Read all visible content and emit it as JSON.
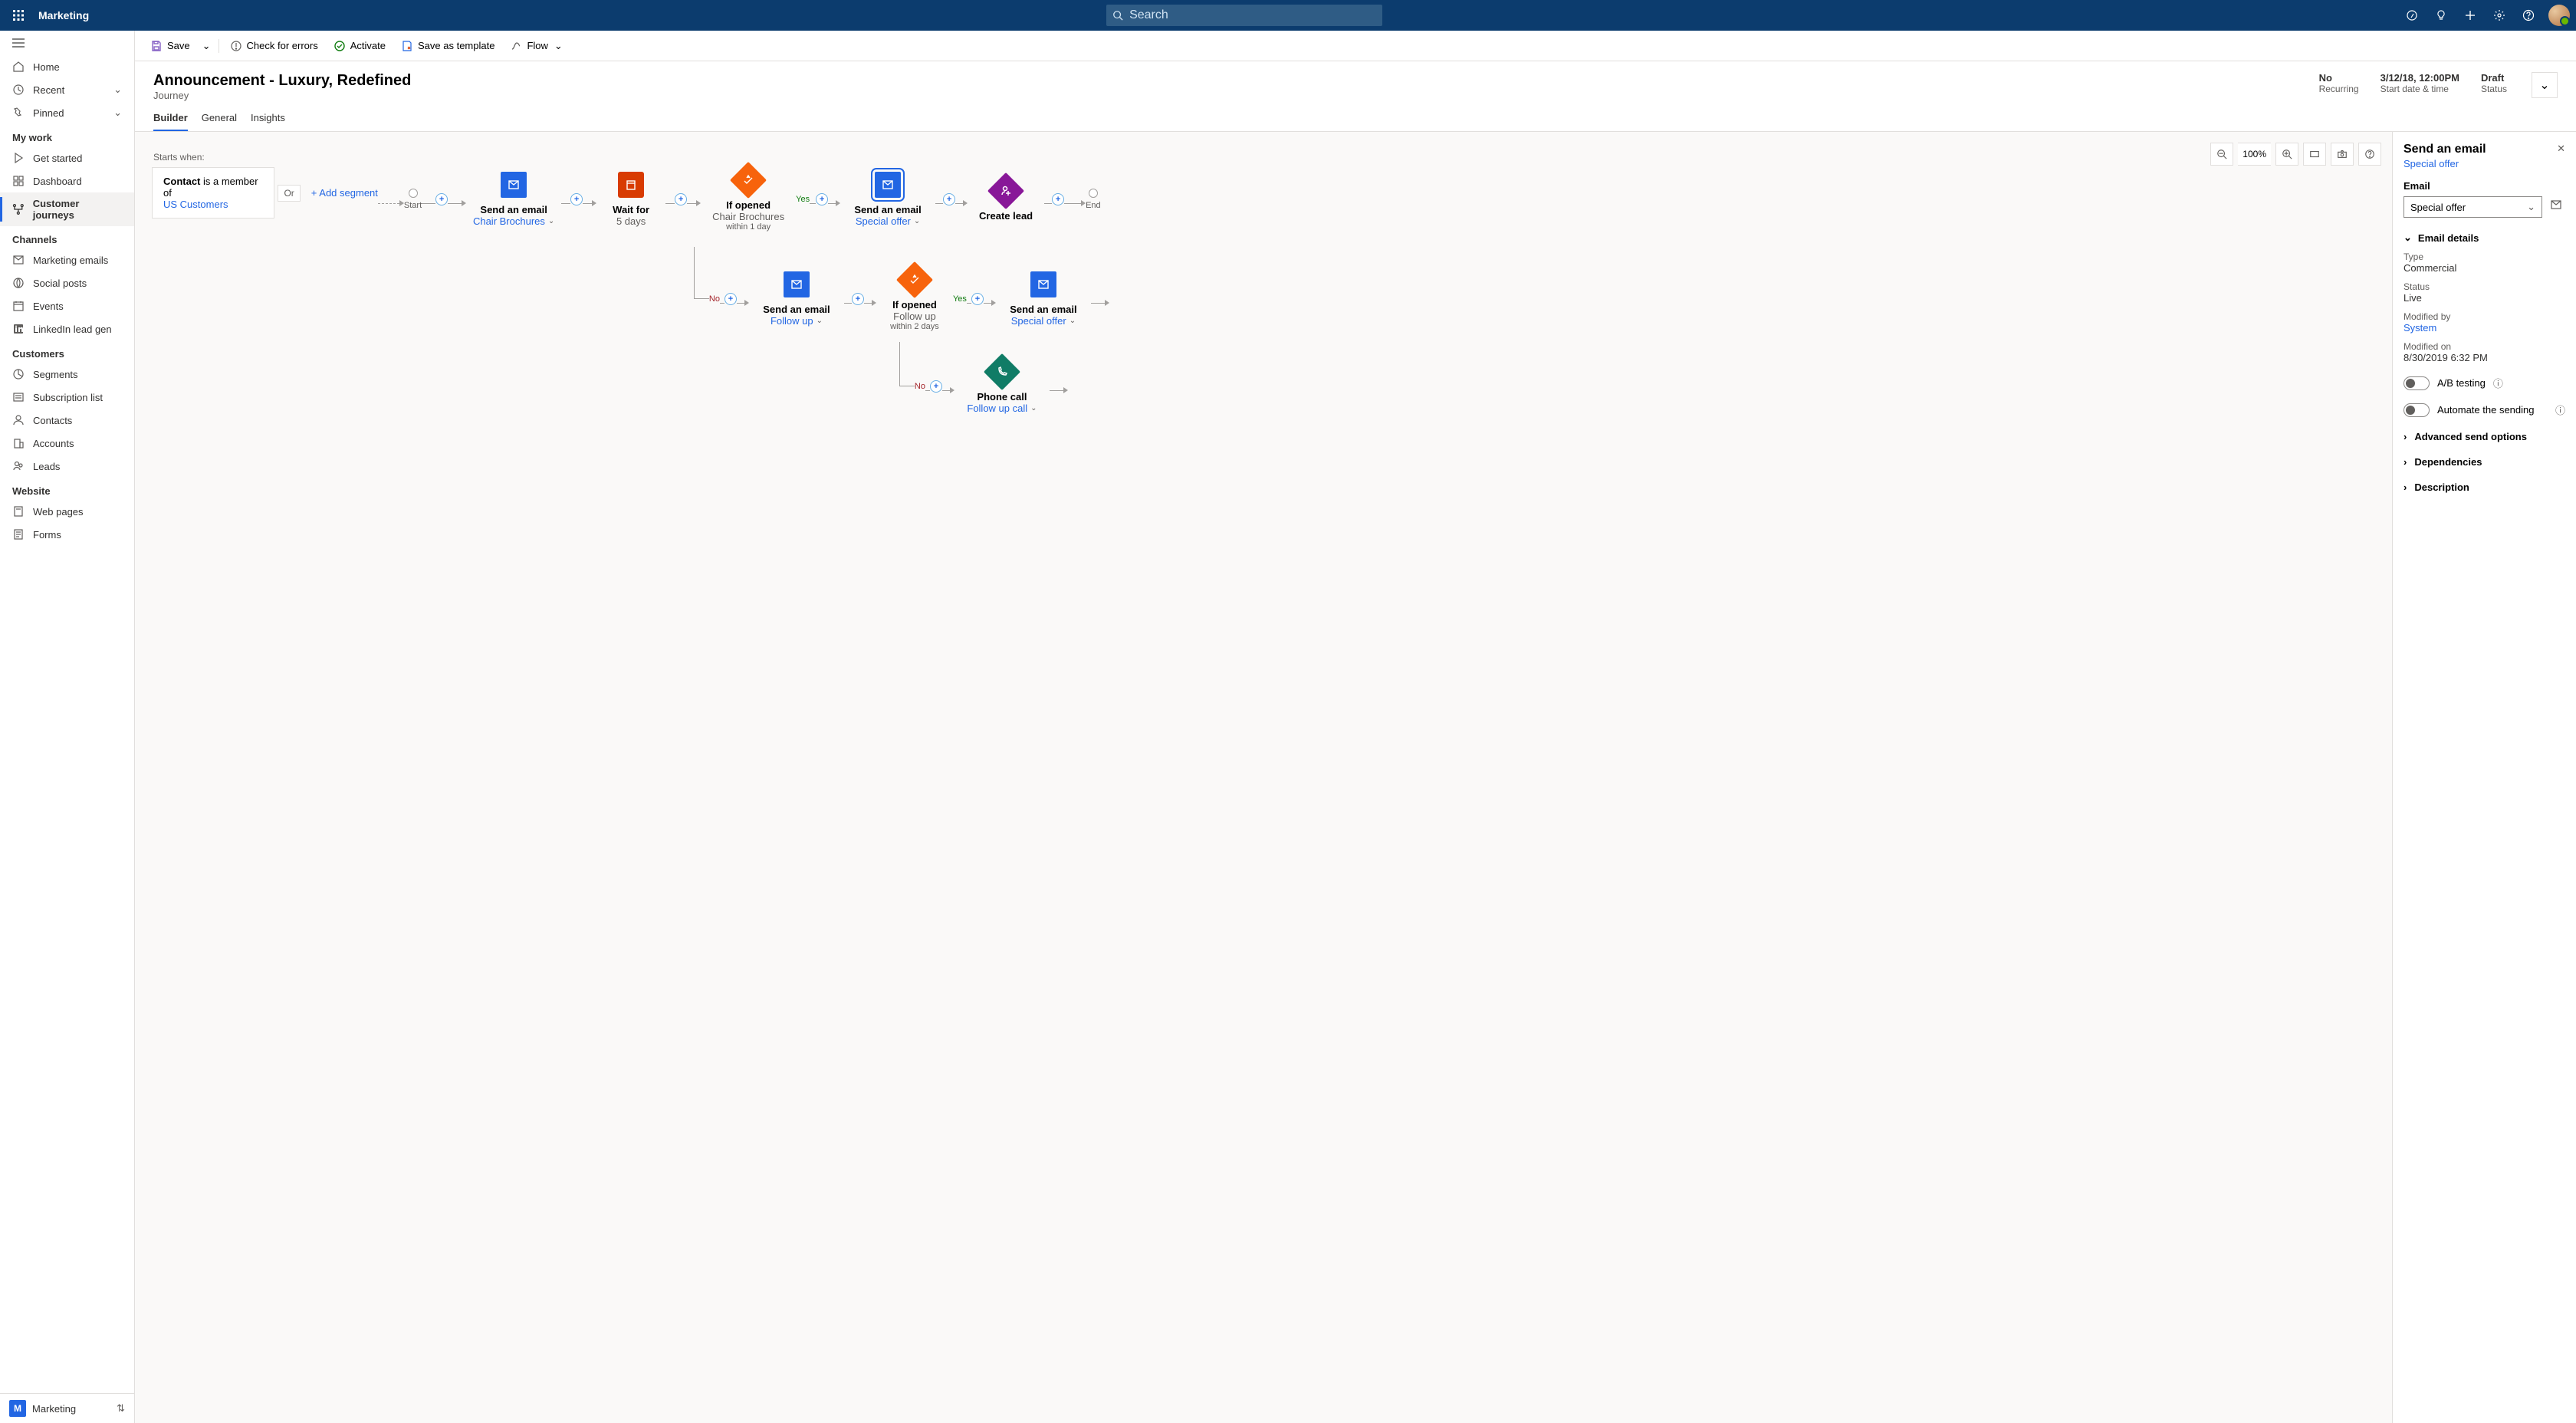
{
  "app_title": "Marketing",
  "search_placeholder": "Search",
  "sidebar": {
    "home": "Home",
    "recent": "Recent",
    "pinned": "Pinned",
    "sections": {
      "my_work": "My work",
      "channels": "Channels",
      "customers": "Customers",
      "website": "Website"
    },
    "items": {
      "get_started": "Get started",
      "dashboard": "Dashboard",
      "customer_journeys": "Customer journeys",
      "marketing_emails": "Marketing emails",
      "social_posts": "Social posts",
      "events": "Events",
      "linkedin": "LinkedIn lead gen",
      "segments": "Segments",
      "subscription_list": "Subscription list",
      "contacts": "Contacts",
      "accounts": "Accounts",
      "leads": "Leads",
      "web_pages": "Web pages",
      "forms": "Forms"
    },
    "area_letter": "M",
    "area_name": "Marketing"
  },
  "commands": {
    "save": "Save",
    "check": "Check for errors",
    "activate": "Activate",
    "save_as_template": "Save as template",
    "flow": "Flow"
  },
  "header": {
    "title": "Announcement - Luxury, Redefined",
    "subtitle": "Journey",
    "meta": {
      "recurring_val": "No",
      "recurring_lbl": "Recurring",
      "start_val": "3/12/18, 12:00PM",
      "start_lbl": "Start date & time",
      "status_val": "Draft",
      "status_lbl": "Status"
    }
  },
  "tabs": {
    "builder": "Builder",
    "general": "General",
    "insights": "Insights"
  },
  "canvas": {
    "zoom": "100%",
    "starts_when": "Starts when:",
    "contact": "Contact",
    "is_member": "is a member of",
    "segment": "US Customers",
    "or": "Or",
    "add_segment": "+ Add segment",
    "start": "Start",
    "end": "End",
    "yes": "Yes",
    "no": "No",
    "nodes": {
      "n1": {
        "title": "Send an email",
        "sub": "Chair Brochures"
      },
      "n2": {
        "title": "Wait for",
        "sub": "5 days"
      },
      "n3": {
        "title": "If opened",
        "sub": "Chair Brochures",
        "sm": "within 1 day"
      },
      "n4": {
        "title": "Send an email",
        "sub": "Special offer"
      },
      "n5": {
        "title": "Create lead"
      },
      "n6": {
        "title": "Send an email",
        "sub": "Follow up"
      },
      "n7": {
        "title": "If opened",
        "sub": "Follow up",
        "sm": "within 2 days"
      },
      "n8": {
        "title": "Send an email",
        "sub": "Special offer"
      },
      "n9": {
        "title": "Phone call",
        "sub": "Follow up call"
      }
    }
  },
  "rpanel": {
    "title": "Send an email",
    "sub": "Special offer",
    "email_label": "Email",
    "email_value": "Special offer",
    "details": "Email details",
    "type_lbl": "Type",
    "type_val": "Commercial",
    "status_lbl": "Status",
    "status_val": "Live",
    "modby_lbl": "Modified by",
    "modby_val": "System",
    "modon_lbl": "Modified on",
    "modon_val": "8/30/2019  6:32 PM",
    "ab_testing": "A/B testing",
    "automate": "Automate the sending",
    "adv": "Advanced send options",
    "deps": "Dependencies",
    "desc": "Description"
  }
}
